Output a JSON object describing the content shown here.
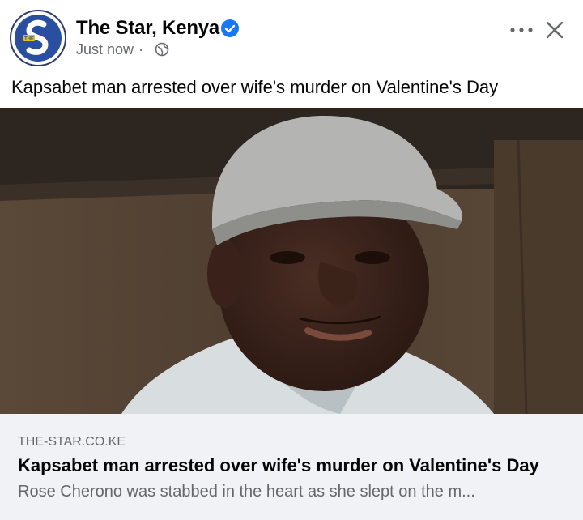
{
  "header": {
    "page_name": "The Star, Kenya",
    "timestamp": "Just now",
    "separator": "·",
    "verified": true
  },
  "avatar": {
    "logo_letter": "S",
    "logo_small_text": "THE",
    "colors": {
      "ring": "#2d3a6e",
      "bg": "#2a4fa0"
    }
  },
  "post": {
    "caption": "Kapsabet man arrested over wife's murder on Valentine's Day"
  },
  "link_preview": {
    "domain": "THE-STAR.CO.KE",
    "title": "Kapsabet man arrested over wife's murder on Valentine's Day",
    "description": "Rose Cherono was stabbed in the heart as she slept on the m..."
  },
  "icons": {
    "verified": "verified-badge-icon",
    "audience": "globe-icon",
    "more": "more-options-icon",
    "close": "close-icon"
  },
  "colors": {
    "verified_blue": "#1877f2",
    "secondary_text": "#65676b",
    "preview_bg": "#f0f2f5"
  }
}
